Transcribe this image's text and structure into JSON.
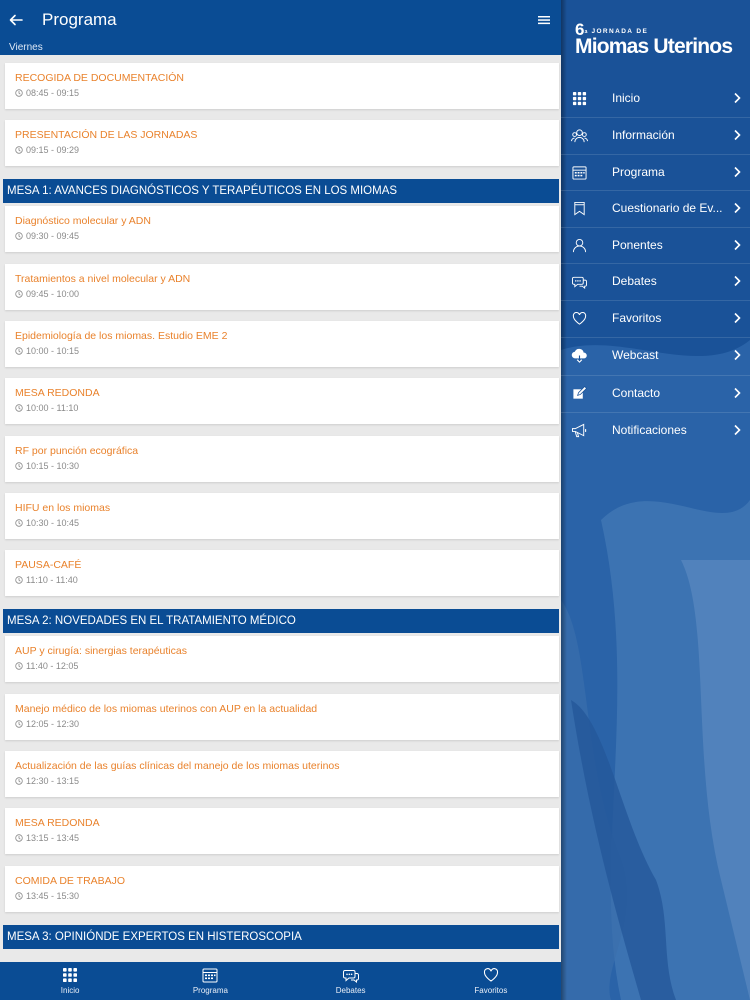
{
  "header": {
    "title": "Programa",
    "day": "Viernes"
  },
  "schedule": {
    "pre_items": [
      {
        "title": "RECOGIDA DE DOCUMENTACIÓN",
        "time": "08:45 - 09:15"
      },
      {
        "title": "PRESENTACIÓN DE LAS JORNADAS",
        "time": "09:15 - 09:29"
      }
    ],
    "sections": [
      {
        "title": "MESA 1: AVANCES DIAGNÓSTICOS Y TERAPÉUTICOS EN LOS MIOMAS",
        "items": [
          {
            "title": "Diagnóstico molecular y ADN",
            "time": "09:30 - 09:45"
          },
          {
            "title": "Tratamientos a nivel molecular y ADN",
            "time": "09:45 - 10:00"
          },
          {
            "title": "Epidemiología de los miomas. Estudio EME 2",
            "time": "10:00 - 10:15"
          },
          {
            "title": "MESA REDONDA",
            "time": "10:00 - 11:10"
          },
          {
            "title": "RF por punción ecográfica",
            "time": "10:15 - 10:30"
          },
          {
            "title": "HIFU en los miomas",
            "time": "10:30 - 10:45"
          },
          {
            "title": "PAUSA-CAFÉ",
            "time": "11:10 - 11:40"
          }
        ]
      },
      {
        "title": "MESA 2: NOVEDADES EN EL TRATAMIENTO MÉDICO",
        "items": [
          {
            "title": "AUP y cirugía: sinergias terapéuticas",
            "time": "11:40 - 12:05"
          },
          {
            "title": "Manejo médico de los miomas uterinos con AUP en la actualidad",
            "time": "12:05 - 12:30"
          },
          {
            "title": "Actualización de las guías clínicas del manejo de los miomas uterinos",
            "time": "12:30 - 13:15"
          },
          {
            "title": "MESA REDONDA",
            "time": "13:15 - 13:45"
          },
          {
            "title": "COMIDA DE TRABAJO",
            "time": "13:45 - 15:30"
          }
        ]
      },
      {
        "title": "MESA 3: OPINIÓNDE EXPERTOS EN HISTEROSCOPIA",
        "items": []
      }
    ]
  },
  "tabbar": {
    "tabs": [
      {
        "label": "Inicio",
        "icon": "grid-icon"
      },
      {
        "label": "Programa",
        "icon": "calendar-icon"
      },
      {
        "label": "Debates",
        "icon": "chat-icon"
      },
      {
        "label": "Favoritos",
        "icon": "heart-icon"
      }
    ]
  },
  "drawer": {
    "logo": {
      "number": "6",
      "ordinal": "ª",
      "small": "JORNADA DE",
      "big": "Miomas Uterinos"
    },
    "items": [
      {
        "label": "Inicio",
        "icon": "grid-icon"
      },
      {
        "label": "Información",
        "icon": "info-people-icon"
      },
      {
        "label": "Programa",
        "icon": "calendar-icon"
      },
      {
        "label": "Cuestionario de Ev...",
        "icon": "bookmark-icon"
      },
      {
        "label": "Ponentes",
        "icon": "person-icon"
      },
      {
        "label": "Debates",
        "icon": "chat-icon"
      },
      {
        "label": "Favoritos",
        "icon": "heart-icon"
      },
      {
        "label": "Webcast",
        "icon": "cloud-download-icon"
      },
      {
        "label": "Contacto",
        "icon": "edit-icon"
      },
      {
        "label": "Notificaciones",
        "icon": "megaphone-icon"
      }
    ]
  },
  "colors": {
    "primary": "#0a4c94",
    "accent": "#e9822c",
    "drawer": "#1a5298",
    "background": "#e9e9e9"
  }
}
